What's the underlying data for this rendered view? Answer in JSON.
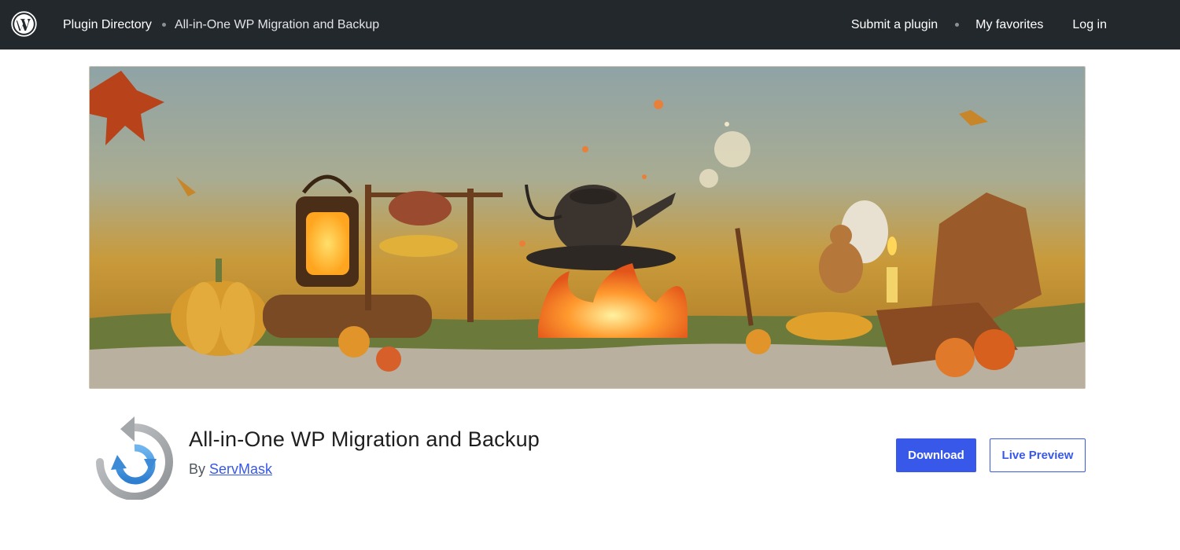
{
  "header": {
    "logo_icon": "wordpress-logo-icon",
    "breadcrumb": {
      "directory": "Plugin Directory",
      "current": "All-in-One WP Migration and Backup"
    },
    "nav": {
      "submit": "Submit a plugin",
      "favorites": "My favorites",
      "login": "Log in"
    }
  },
  "banner": {
    "image": "autumn-campfire-scene-illustration"
  },
  "plugin": {
    "icon": "circular-arrow-migration-icon",
    "title": "All-in-One WP Migration and Backup",
    "by_prefix": "By ",
    "author": "ServMask"
  },
  "actions": {
    "download": "Download",
    "live_preview": "Live Preview"
  },
  "colors": {
    "topbar": "#23282d",
    "accent": "#3858e9"
  }
}
